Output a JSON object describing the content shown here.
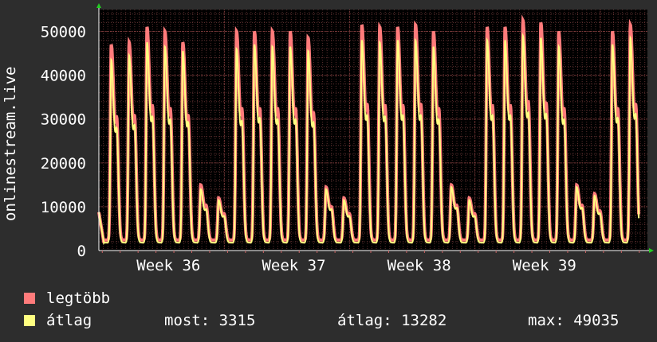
{
  "chart_data": {
    "type": "area",
    "title": "",
    "ylabel": "onlinestream.live",
    "xlabel": "",
    "ylim": [
      0,
      55000
    ],
    "yticks": [
      0,
      10000,
      20000,
      30000,
      40000,
      50000
    ],
    "x_week_labels": [
      "Week 36",
      "Week 37",
      "Week 38",
      "Week 39"
    ],
    "grid": true,
    "series": [
      {
        "name": "legtöbb",
        "color": "#ff7b7b",
        "daily_peaks": [
          47000,
          47500,
          51000,
          50000,
          47500,
          15000,
          12000,
          50000,
          50000,
          50000,
          50000,
          48500,
          14500,
          12000,
          51500,
          51000,
          51000,
          51500,
          50000,
          15000,
          12000,
          51000,
          51000,
          52500,
          52000,
          50000,
          15000,
          13000,
          50000,
          51500
        ]
      },
      {
        "name": "átlag",
        "color": "#ffff80",
        "daily_peaks": [
          43500,
          44500,
          47500,
          46500,
          45500,
          14000,
          11500,
          46000,
          47000,
          46500,
          46500,
          45500,
          14000,
          11500,
          48000,
          47500,
          48000,
          48000,
          46500,
          14500,
          11500,
          48000,
          48000,
          49000,
          48500,
          46500,
          14500,
          12500,
          47000,
          48500
        ]
      }
    ]
  },
  "legend": [
    {
      "label": "legtöbb",
      "color": "#ff7b7b"
    },
    {
      "label": "átlag",
      "color": "#ffff80"
    }
  ],
  "stats": {
    "now": "most: 3315",
    "avg": "átlag: 13282",
    "max": "max: 49035"
  },
  "colors": {
    "background": "#2d2d2d",
    "canvas": "#000000",
    "grid_minor": "#5a2e2e",
    "grid_major": "#7a3838",
    "axis": "#ffffff",
    "arrow": "#22cc22"
  }
}
